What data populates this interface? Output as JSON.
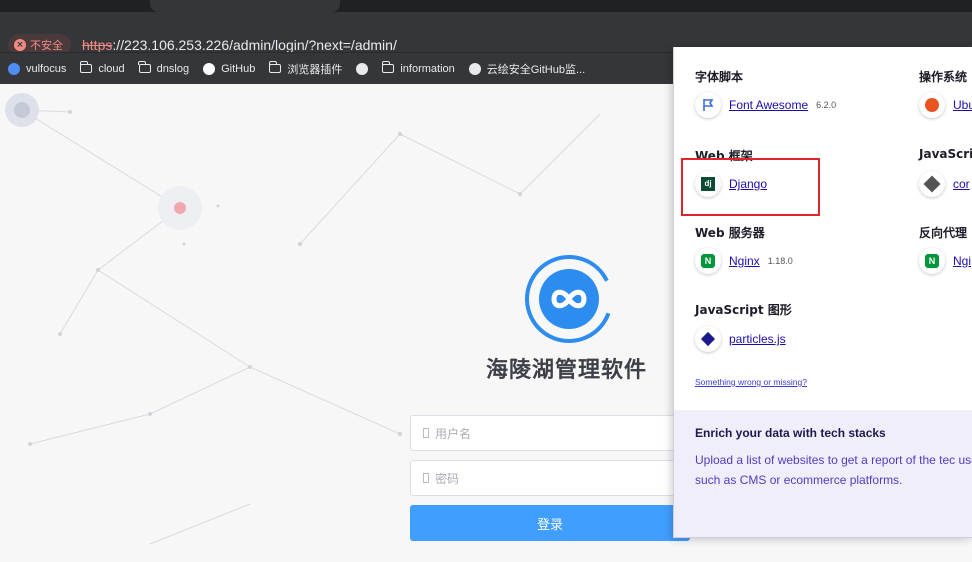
{
  "browser": {
    "security_chip": "不安全",
    "url_scheme": "https",
    "url_rest": "://223.106.253.226/admin/login/?next=/admin/",
    "bookmarks": [
      {
        "icon": "shield-icon",
        "label": "vulfocus"
      },
      {
        "icon": "folder-icon",
        "label": "cloud"
      },
      {
        "icon": "folder-icon",
        "label": "dnslog"
      },
      {
        "icon": "github-icon",
        "label": "GitHub"
      },
      {
        "icon": "folder-icon",
        "label": "浏览器插件"
      },
      {
        "icon": "globe-icon",
        "label": ""
      },
      {
        "icon": "folder-icon",
        "label": "information"
      },
      {
        "icon": "globe-icon",
        "label": "云绘安全GitHub监..."
      }
    ]
  },
  "login": {
    "app_title": "海陵湖管理软件",
    "username_placeholder": "用户名",
    "password_placeholder": "密码",
    "login_button": "登录",
    "logo_color": "#2d8cf0",
    "button_color": "#409eff"
  },
  "wappalyzer": {
    "categories": [
      {
        "title": "字体脚本",
        "techs": [
          {
            "icon": "flag-icon",
            "name": "Font Awesome",
            "version": "6.2.0"
          }
        ]
      },
      {
        "title": "操作系统",
        "techs": [
          {
            "icon": "ubuntu-icon",
            "name": "Ubu",
            "version": ""
          }
        ]
      },
      {
        "title": "Web 框架",
        "techs": [
          {
            "icon": "django-icon",
            "name": "Django",
            "version": ""
          }
        ]
      },
      {
        "title": "JavaScri",
        "techs": [
          {
            "icon": "core-js-icon",
            "name": "cor",
            "version": ""
          }
        ]
      },
      {
        "title": "Web 服务器",
        "techs": [
          {
            "icon": "nginx-icon",
            "name": "Nginx",
            "version": "1.18.0"
          }
        ]
      },
      {
        "title": "反向代理",
        "techs": [
          {
            "icon": "nginx-icon",
            "name": "Ngi",
            "version": ""
          }
        ]
      },
      {
        "title": "JavaScript 图形",
        "techs": [
          {
            "icon": "particles-icon",
            "name": "particles.js",
            "version": ""
          }
        ]
      }
    ],
    "wrong_link": "Something wrong or missing?",
    "enrich_title": "Enrich your data with tech stacks",
    "enrich_text": "Upload a list of websites to get a report of the tec use, such as CMS or ecommerce platforms."
  }
}
